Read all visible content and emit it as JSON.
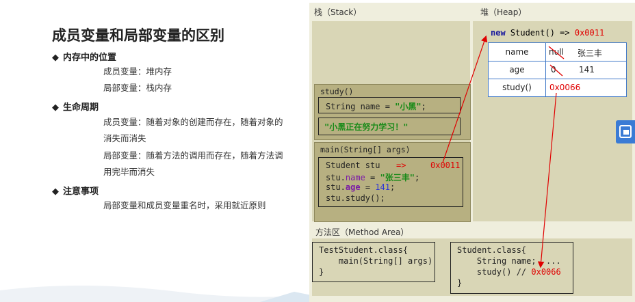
{
  "slide": {
    "title": "成员变量和局部变量的区别",
    "sections": [
      {
        "heading": "内存中的位置",
        "lines": [
          "成员变量：堆内存",
          "局部变量：栈内存"
        ]
      },
      {
        "heading": "生命周期",
        "lines": [
          "成员变量：随着对象的创建而存在，随着对象的",
          "消失而消失",
          "局部变量：随着方法的调用而存在，随着方法调",
          "用完毕而消失"
        ]
      },
      {
        "heading": "注意事项",
        "lines": [
          "局部变量和成员变量重名时，采用就近原则"
        ]
      }
    ]
  },
  "diagram": {
    "stack_label": "栈（Stack）",
    "heap_label": "堆（Heap）",
    "method_area_label": "方法区（Method Area）",
    "study_frame": {
      "title": "study()",
      "line1": "String name = \"小黑\";",
      "line2": "\"小黑正在努力学习！\""
    },
    "main_frame": {
      "title": "main(String[] args)",
      "l1_code": "Student stu",
      "l1_arrow": "=>",
      "l1_addr": "0x0011",
      "l2_a": "stu.",
      "l2_b": "name",
      "l2_c": " = ",
      "l2_d": "\"张三丰\"",
      "l2_e": ";",
      "l3_a": "stu.",
      "l3_b": "age",
      "l3_c": " = ",
      "l3_d": "141",
      "l3_e": ";",
      "l4": "stu.study();"
    },
    "heap": {
      "header_new": "new",
      "header_rest": " Student() => ",
      "header_addr": "0x0011",
      "rows": [
        {
          "field": "name",
          "old": "null",
          "value": "张三丰"
        },
        {
          "field": "age",
          "old": "0",
          "value": "141"
        },
        {
          "field": "study()",
          "old": "",
          "value": "0x0066"
        }
      ]
    },
    "method_area": {
      "test_class": [
        "TestStudent.class{",
        "    main(String[] args)",
        "}"
      ],
      "student_class": {
        "l1": "Student.class{",
        "l2": "    String name;  ",
        "l2_dots": "...",
        "l3": "    study() // ",
        "l3_addr": "0x0066",
        "l4": "}"
      }
    }
  },
  "colors": {
    "diagram_bg": "#efeedd",
    "frame": "#b7b081",
    "accent_red": "#e00000",
    "heap_border": "#3f78c8"
  }
}
